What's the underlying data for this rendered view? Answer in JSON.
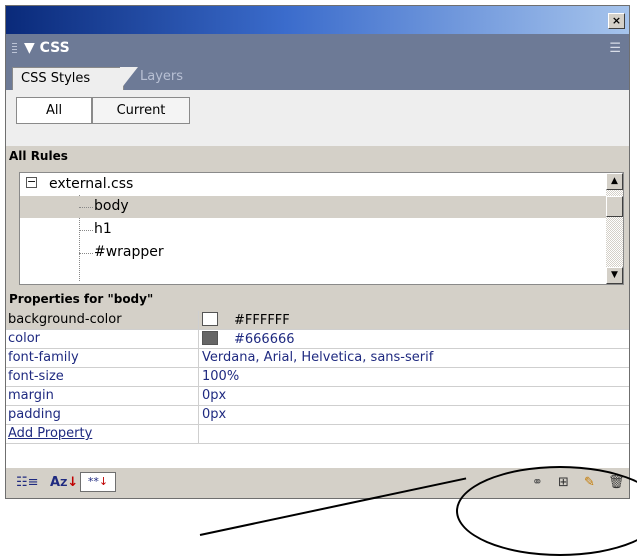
{
  "panel": {
    "title": "CSS",
    "close_glyph": "×",
    "menu_glyph": "☰"
  },
  "tabs": [
    {
      "label": "CSS Styles"
    },
    {
      "label": "Layers"
    }
  ],
  "segments": [
    {
      "label": "All"
    },
    {
      "label": "Current"
    }
  ],
  "rules_section": {
    "heading": "All Rules",
    "items": [
      "external.css",
      "body",
      "h1",
      "#wrapper"
    ]
  },
  "properties_section": {
    "heading": "Properties for \"body\"",
    "rows": [
      {
        "name": "background-color",
        "value": "#FFFFFF",
        "swatch": "#FFFFFF"
      },
      {
        "name": "color",
        "value": "#666666",
        "swatch": "#666666"
      },
      {
        "name": "font-family",
        "value": "Verdana, Arial, Helvetica, sans-serif"
      },
      {
        "name": "font-size",
        "value": "100%"
      },
      {
        "name": "margin",
        "value": "0px"
      },
      {
        "name": "padding",
        "value": "0px"
      }
    ],
    "add_link": "Add Property"
  },
  "footer": {
    "left_icons": [
      "category-view-icon",
      "az-sort-icon",
      "set-properties-icon"
    ],
    "right_icons": [
      "attach-style-sheet-icon",
      "new-css-rule-icon",
      "edit-style-icon",
      "delete-icon"
    ]
  }
}
